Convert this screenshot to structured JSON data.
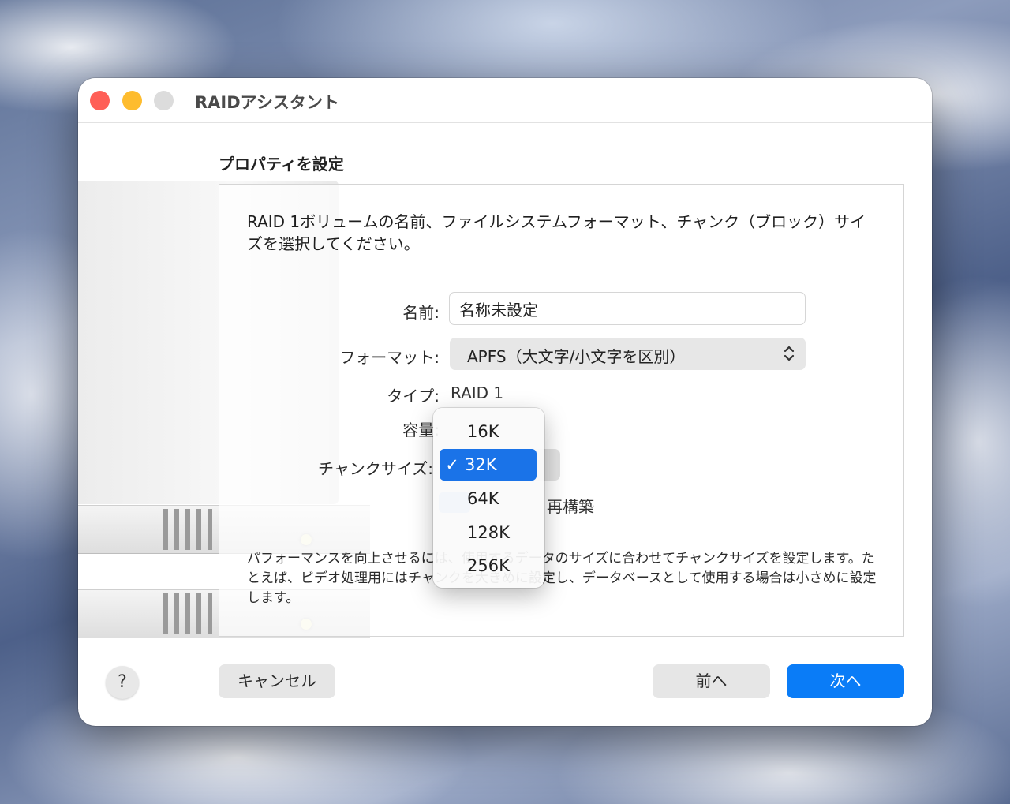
{
  "window": {
    "title": "RAIDアシスタント"
  },
  "section_title": "プロパティを設定",
  "description": "RAID 1ボリュームの名前、ファイルシステムフォーマット、チャンク（ブロック）サイズを選択してください。",
  "form": {
    "name_label": "名前:",
    "name_value": "名称未設定",
    "format_label": "フォーマット:",
    "format_value": "APFS（大文字/小文字を区別）",
    "type_label": "タイプ:",
    "type_value": "RAID 1",
    "capacity_label": "容量:",
    "chunk_label": "チャンクサイズ:",
    "checkbox_label": "再構築"
  },
  "chunk_menu": {
    "options": [
      "16K",
      "32K",
      "64K",
      "128K",
      "256K"
    ],
    "selected": "32K",
    "check": "✓"
  },
  "help_text": "パフォーマンスを向上させるには、使用するデータのサイズに合わせてチャンクサイズを設定します。たとえば、ビデオ処理用にはチャンクを大きめに設定し、データベースとして使用する場合は小さめに設定します。",
  "buttons": {
    "help": "?",
    "cancel": "キャンセル",
    "back": "前へ",
    "next": "次へ"
  },
  "colors": {
    "accent": "#0a7cf7",
    "close": "#ff5f57",
    "minimize": "#febc2e"
  }
}
